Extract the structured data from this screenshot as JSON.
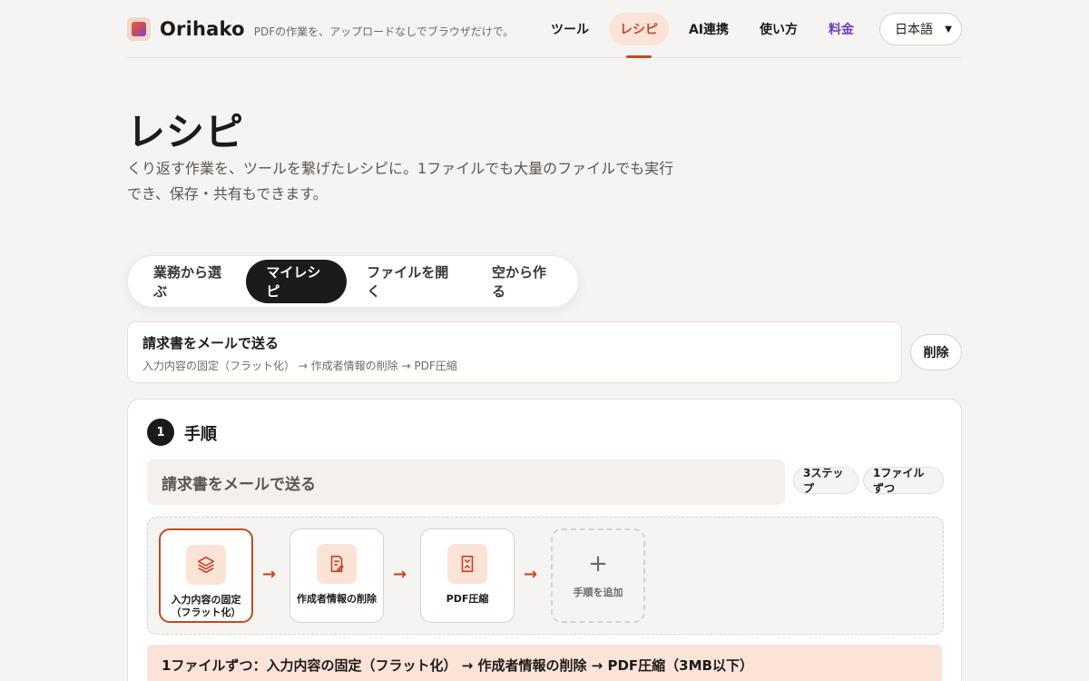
{
  "header": {
    "brand": "Orihako",
    "tagline": "PDFの作業を、アップロードなしでブラウザだけで。",
    "nav": [
      "ツール",
      "レシピ",
      "AI連携",
      "使い方",
      "料金"
    ],
    "language": "日本語"
  },
  "page": {
    "title": "レシピ",
    "description": "くり返す作業を、ツールを繋げたレシピに。1ファイルでも大量のファイルでも実行でき、保存・共有もできます。"
  },
  "tabs": [
    "業務から選ぶ",
    "マイレシピ",
    "ファイルを開く",
    "空から作る"
  ],
  "recipe": {
    "name": "請求書をメールで送る",
    "steps_text": "入力内容の固定（フラット化） → 作成者情報の削除 → PDF圧縮",
    "delete_label": "削除"
  },
  "panel": {
    "step_number": "1",
    "heading": "手順",
    "name_value": "請求書をメールで送る",
    "badge_steps": "3ステップ",
    "badge_mode": "1ファイルずつ",
    "steps": [
      {
        "label": "入力内容の固定（フラット化）",
        "icon": "layers-icon"
      },
      {
        "label": "作成者情報の削除",
        "icon": "document-edit-icon"
      },
      {
        "label": "PDF圧縮",
        "icon": "compress-icon"
      }
    ],
    "add_label": "手順を追加",
    "summary": "1ファイルずつ：入力内容の固定（フラット化） → 作成者情報の削除 → PDF圧縮（3MB以下）"
  }
}
